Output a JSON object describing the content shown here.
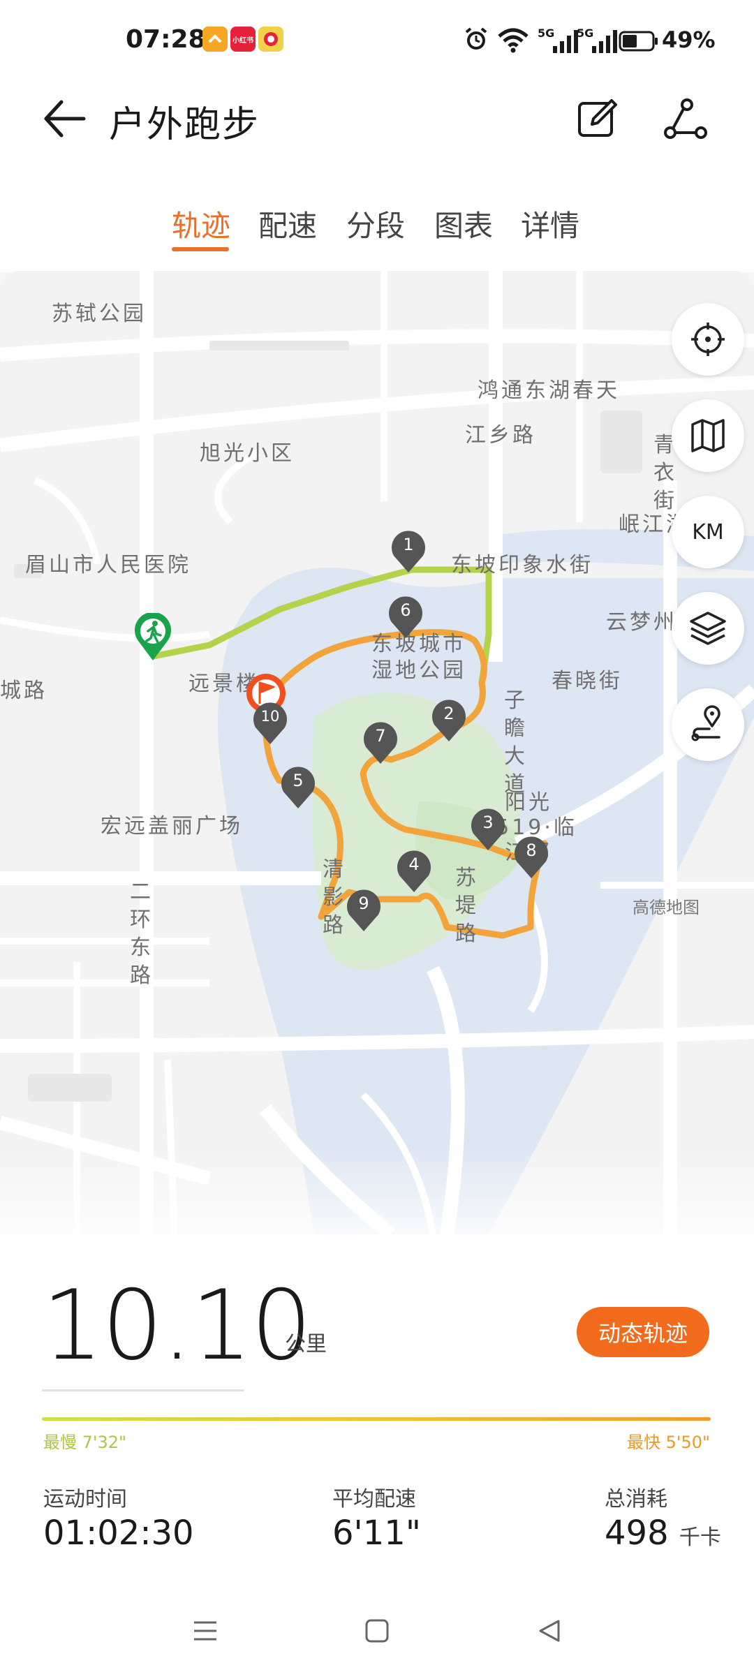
{
  "status_bar": {
    "time": "07:28",
    "apps": [
      {
        "icon": "app-icon-1",
        "color": "#f5a623",
        "label": ""
      },
      {
        "icon": "xiaohongshu-icon",
        "color": "#e8213b",
        "label": "小红书"
      },
      {
        "icon": "app-icon-3",
        "color": "#f0d24a",
        "label": ""
      }
    ],
    "signal_labels": [
      "5G",
      "5G"
    ],
    "battery_percent": "49%"
  },
  "header": {
    "title": "户外跑步",
    "tabs": [
      "轨迹",
      "配速",
      "分段",
      "图表",
      "详情"
    ],
    "active_tab": 0
  },
  "map": {
    "labels": {
      "sushi_park": "苏轼公园",
      "hongtong": "鸿通东湖春天",
      "jiangxiang_road": "江乡路",
      "xuguang": "旭光小区",
      "hospital": "眉山市人民医院",
      "dongpo_yinxiang": "东坡印象水街",
      "minjiang": "岷江湖畔",
      "yunmengzhou": "云梦州",
      "wetland": "东坡城市湿地公园",
      "chunxiao": "春晓街",
      "yuanjinglou": "远景楼",
      "cheng_road": "城路",
      "zizhan": "子瞻大道",
      "yangguang": "阳光1519·临江邸",
      "hongyuan": "宏远盖丽广场",
      "erhuan": "二环东路",
      "qingying": "清影路",
      "suti": "苏堤路",
      "qingyi": "青衣街",
      "gaode": "高德地图"
    },
    "markers": [
      "1",
      "2",
      "3",
      "4",
      "5",
      "6",
      "7",
      "8",
      "9",
      "10"
    ],
    "side_buttons": [
      "locate-icon",
      "map-icon",
      "KM",
      "layers-icon",
      "route-pin-icon"
    ]
  },
  "summary": {
    "distance": "10.10",
    "distance_unit": "公里",
    "dynamic_track_button": "动态轨迹",
    "slowest": "最慢 7'32\"",
    "fastest": "最快 5'50\"",
    "stats": [
      {
        "label": "运动时间",
        "value": "01:02:30",
        "unit": ""
      },
      {
        "label": "平均配速",
        "value": "6'11\"",
        "unit": ""
      },
      {
        "label": "总消耗",
        "value": "498",
        "unit": "千卡"
      }
    ]
  },
  "colors": {
    "accent": "#e8702a",
    "route_start": "#b5d34a",
    "route_main": "#f2a33a",
    "marker": "#555555",
    "start_marker": "#1aa34a",
    "end_marker": "#f0501f"
  }
}
